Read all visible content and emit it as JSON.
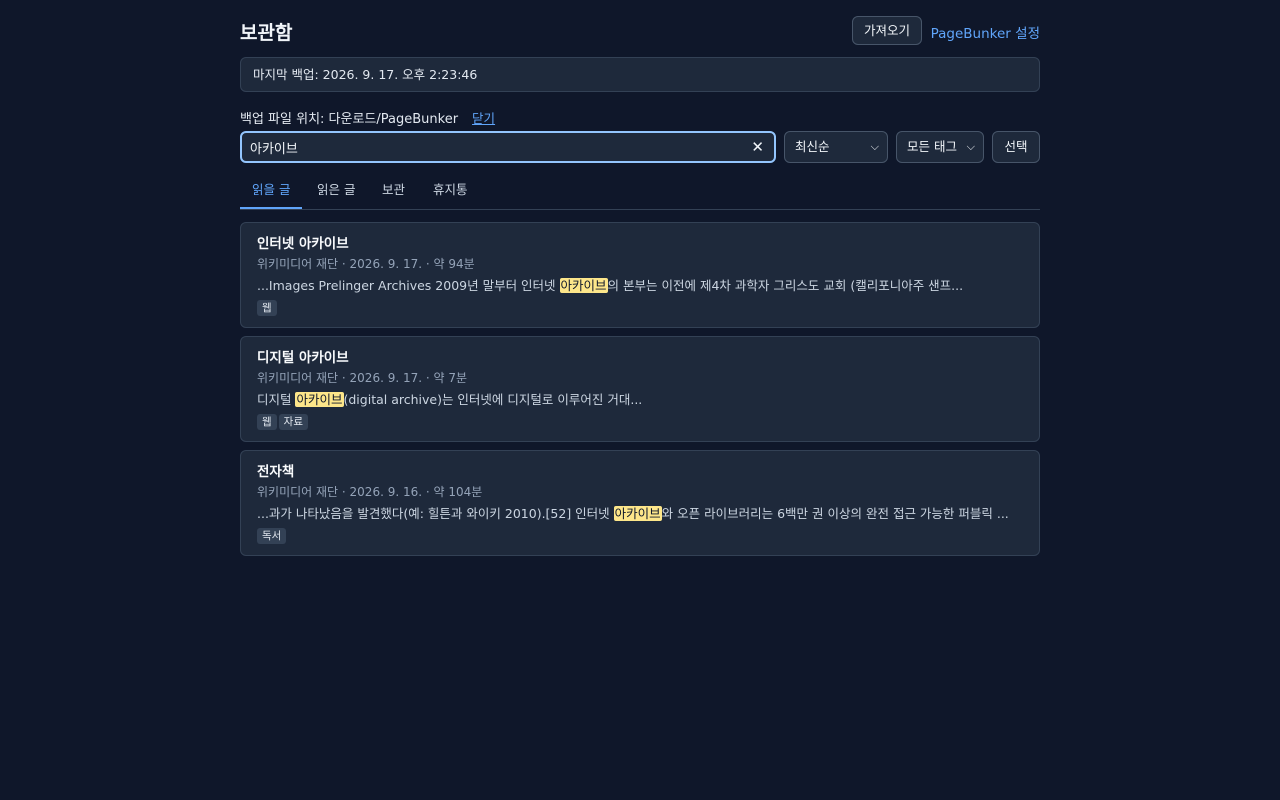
{
  "header": {
    "title": "보관함",
    "import_label": "가져오기",
    "settings_label": "PageBunker 설정"
  },
  "backup": {
    "last_backup": "마지막 백업: 2026. 9. 17. 오후 2:23:46",
    "location": "백업 파일 위치: 다운로드/PageBunker",
    "close_label": "닫기"
  },
  "search": {
    "value": "아카이브",
    "clear_icon": "close-icon"
  },
  "filters": {
    "sort_selected": "최신순",
    "tag_selected": "모든 태그",
    "select_label": "선택"
  },
  "tabs": [
    {
      "label": "읽을 글",
      "active": true
    },
    {
      "label": "읽은 글",
      "active": false
    },
    {
      "label": "보관",
      "active": false
    },
    {
      "label": "휴지통",
      "active": false
    }
  ],
  "articles": [
    {
      "title": "인터넷 아카이브",
      "meta": "위키미디어 재단 · 2026. 9. 17. · 약 94분",
      "snippet_before": "...Images Prelinger Archives 2009년 말부터 인터넷 ",
      "snippet_match": "아카이브",
      "snippet_after": "의 본부는 이전에 제4차 과학자 그리스도 교회 (캘리포니아주 샌프...",
      "tags": [
        "웹"
      ]
    },
    {
      "title": "디지털 아카이브",
      "meta": "위키미디어 재단 · 2026. 9. 17. · 약 7분",
      "snippet_before": "디지털 ",
      "snippet_match": "아카이브",
      "snippet_after": "(digital archive)는 인터넷에 디지털로 이루어진 거대...",
      "tags": [
        "웹",
        "자료"
      ]
    },
    {
      "title": "전자책",
      "meta": "위키미디어 재단 · 2026. 9. 16. · 약 104분",
      "snippet_before": "...과가 나타났음을 발견했다(예: 힐튼과 와이키 2010).[52] 인터넷 ",
      "snippet_match": "아카이브",
      "snippet_after": "와 오픈 라이브러리는 6백만 권 이상의 완전 접근 가능한 퍼블릭 ...",
      "tags": [
        "독서"
      ]
    }
  ],
  "colors": {
    "background": "#0f172a",
    "card": "#1e293b",
    "accent": "#60a5fa",
    "highlight": "#fde68a"
  }
}
